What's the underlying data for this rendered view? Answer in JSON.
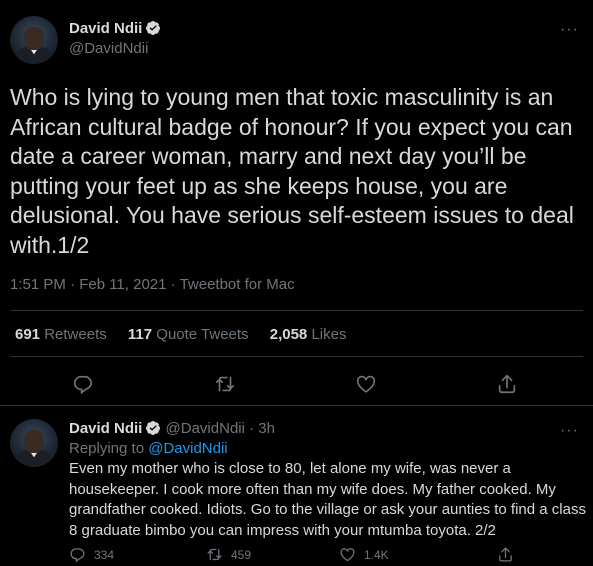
{
  "main_tweet": {
    "author_name": "David Ndii",
    "author_handle": "@DavidNdii",
    "verified": true,
    "text": "Who is lying to young men that toxic masculinity is an African cultural badge of honour? If you expect you can date a career woman, marry and next day you’ll be putting your feet up as she keeps house, you are delusional. You have serious self-esteem issues to deal with.1/2",
    "timestamp": "1:51 PM · Feb 11, 2021",
    "source": "Tweetbot for Mac",
    "stats": {
      "retweets_count": "691",
      "retweets_label": "Retweets",
      "quotes_count": "117",
      "quotes_label": "Quote Tweets",
      "likes_count": "2,058",
      "likes_label": "Likes"
    },
    "more_glyph": "···"
  },
  "reply_tweet": {
    "author_name": "David Ndii",
    "author_handle": "@DavidNdii",
    "time_ago": "3h",
    "replying_prefix": "Replying to",
    "replying_to": "@DavidNdii",
    "text": "Even my mother who is close to 80, let alone my wife, was never a housekeeper. I cook more often than my wife does. My father cooked. My grandfather cooked. Idiots. Go to the village or ask your aunties to find a class 8 graduate bimbo you can impress with your mtumba toyota. 2/2",
    "reply_count": "334",
    "retweet_count": "459",
    "like_count": "1.4K",
    "more_glyph": "···"
  },
  "colors": {
    "background": "#000000",
    "text": "#d9d9d9",
    "muted": "#6e767d",
    "link": "#1d9bf0",
    "divider": "#2f3336"
  },
  "icons": [
    "verified-badge-icon",
    "more-icon",
    "reply-icon",
    "retweet-icon",
    "like-icon",
    "share-icon"
  ]
}
